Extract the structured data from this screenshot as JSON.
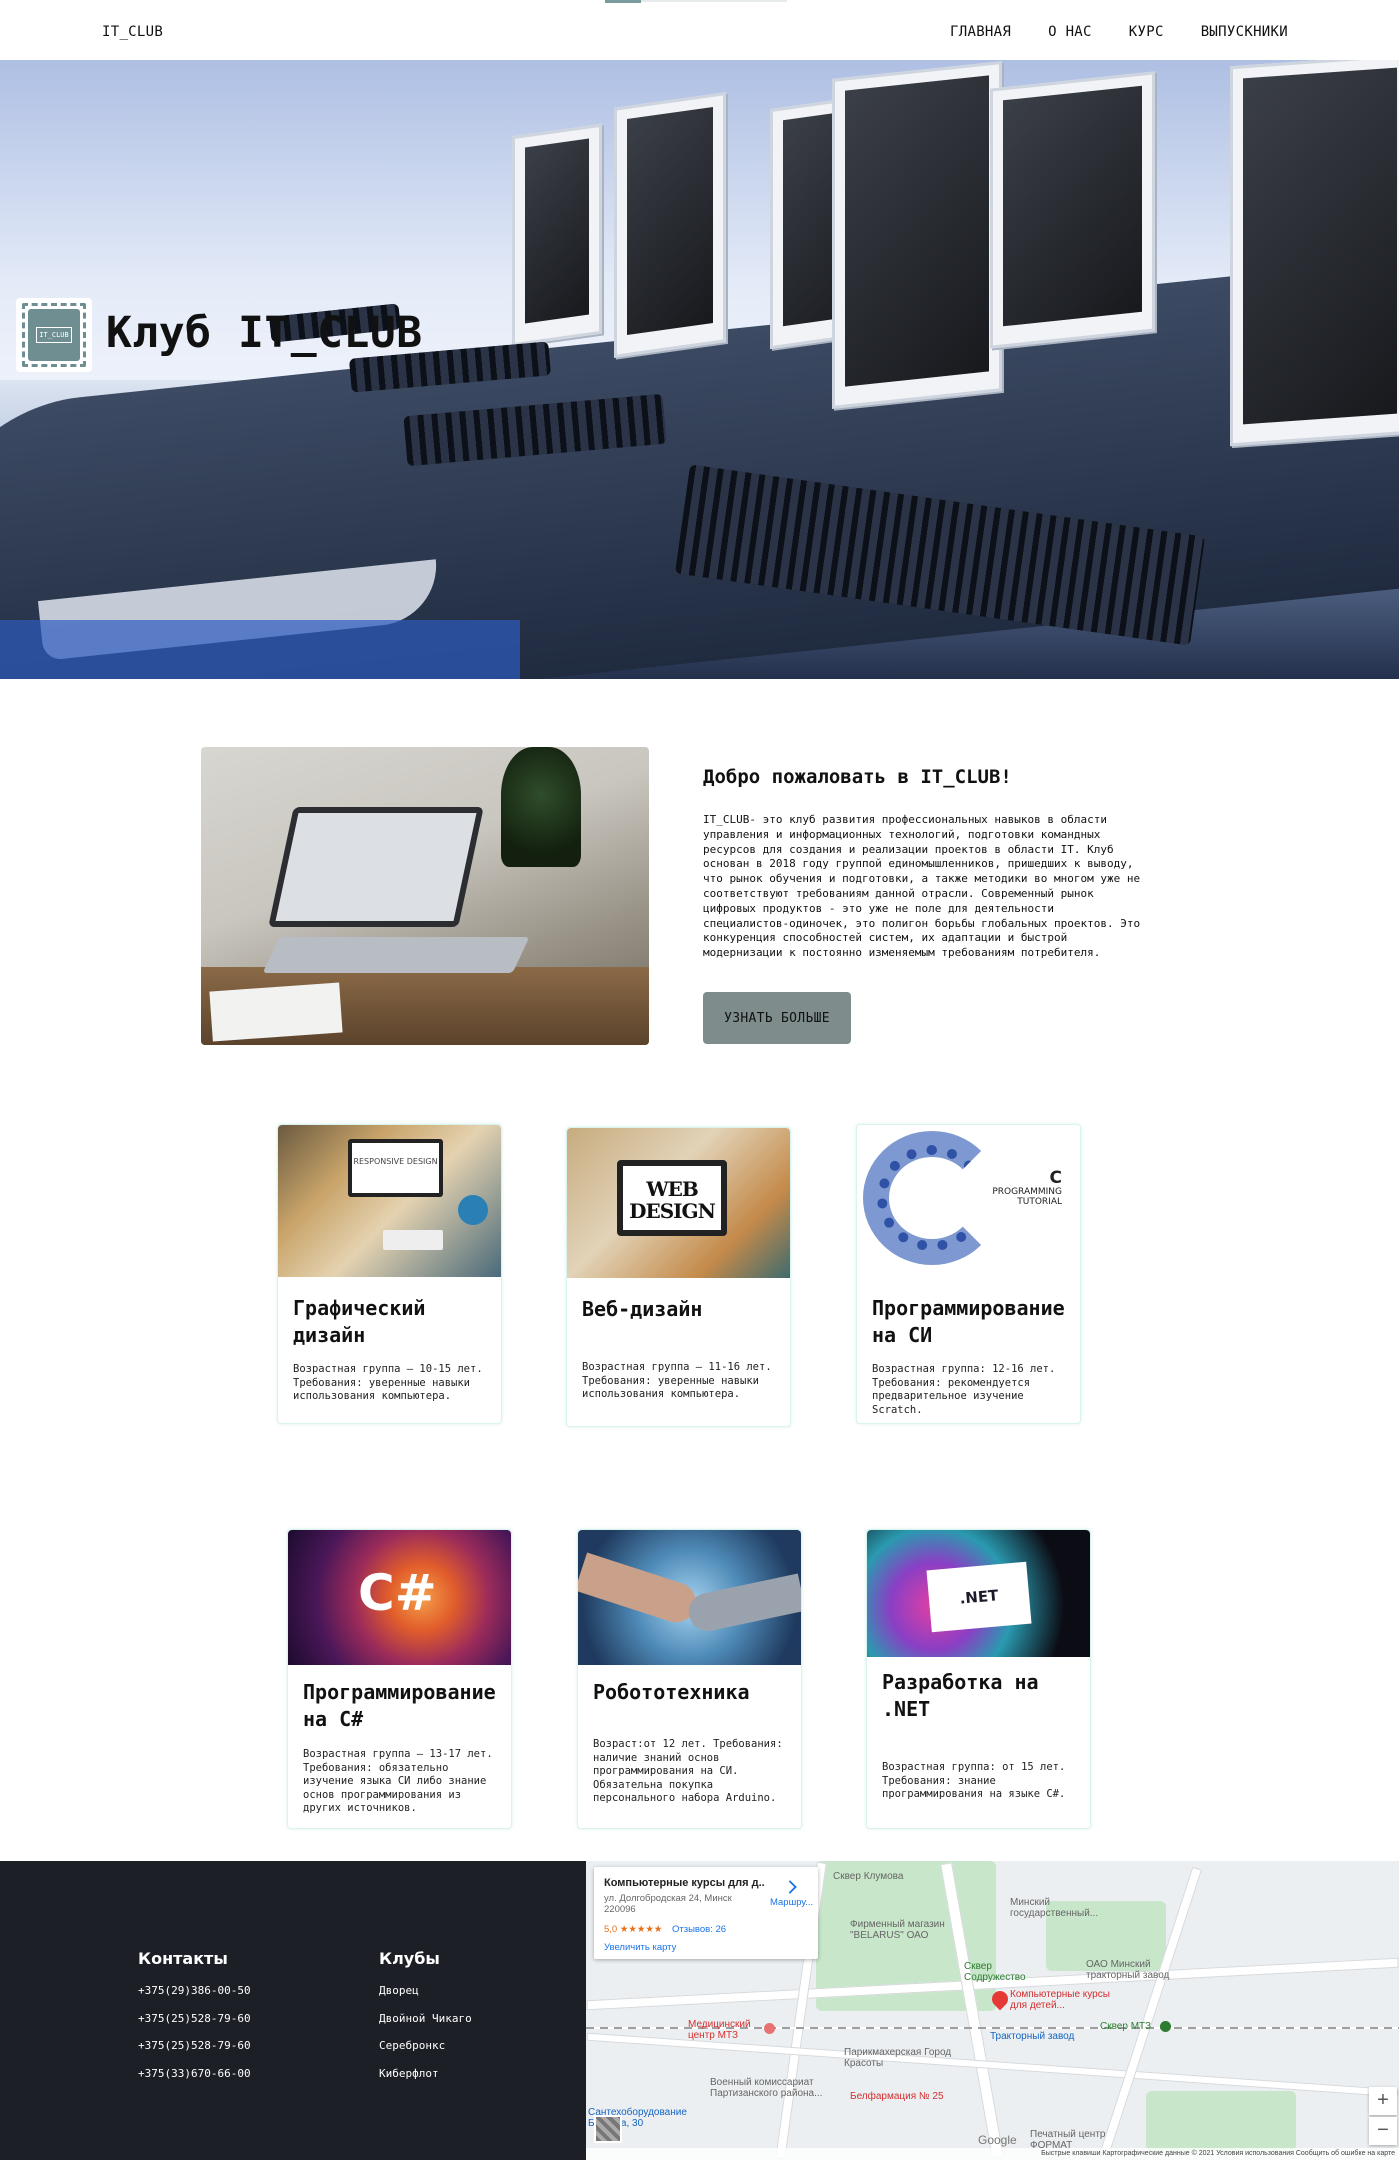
{
  "nav": {
    "brand": "IT_CLUB",
    "items": [
      "ГЛАВНАЯ",
      "О НАС",
      "КУРС",
      "ВЫПУСКНИКИ"
    ]
  },
  "hero": {
    "logo_text": "IT_CLUB",
    "title": "Клуб IT_CLUB"
  },
  "welcome": {
    "title": "Добро пожаловать в IT_CLUB!",
    "text": "IT_CLUB- это клуб развития профессиональных навыков в области управления и информационных технологий, подготовки командных ресурсов для создания и реализации проектов в области IT. Клуб основан в 2018 году группой единомышленников, пришедших к выводу, что рынок обучения и подготовки, а также методики во многом уже не соответствуют требованиям данной отрасли. Современный рынок цифровых продуктов - это уже не поле для деятельности специалистов-одиночек, это полигон борьбы глобальных проектов. Это конкуренция способностей систем, их адаптации и быстрой модернизации к постоянно изменяемым требованиям потребителя.",
    "button": "УЗНАТЬ БОЛЬШЕ"
  },
  "courses_row1": [
    {
      "title": "Графический дизайн",
      "desc": "Возрастная группа – 10-15 лет. Требования: уверенные навыки использования компьютера.",
      "image_text": "RESPONSIVE DESIGN"
    },
    {
      "title": "Веб-дизайн",
      "desc": "Возрастная группа – 11-16 лет. Требования: уверенные навыки использования компьютера.",
      "image_text": "WEB DESIGN"
    },
    {
      "title": "Программирование на СИ",
      "desc": "Возрастная группа: 12-16 лет. Требования: рекомендуется предварительное изучение Scratch.",
      "image_text_big": "C",
      "image_text": "PROGRAMMING TUTORIAL"
    }
  ],
  "courses_row2": [
    {
      "title": "Программирование на C#",
      "desc": "Возрастная группа – 13-17 лет. Требования: обязательно изучение языка СИ либо знание основ программирования из других источников.",
      "image_text": "C#"
    },
    {
      "title": "Робототехника",
      "desc": "Возраст:от 12 лет. Требования: наличие знаний основ программирования на СИ. Обязательна покупка персонального набора Arduino."
    },
    {
      "title": "Разработка на .NET",
      "desc": "Возрастная группа: от 15 лет. Требования: знание программирования на языке C#.",
      "image_text": ".NET"
    }
  ],
  "footer": {
    "contacts_title": "Контакты",
    "phones": [
      "+375(29)386-00-50",
      "+375(25)528-79-60",
      "+375(25)528-79-60",
      "+375(33)670-66-00"
    ],
    "clubs_title": "Клубы",
    "clubs": [
      "Дворец",
      "Двойной Чикаго",
      "Серебронкс",
      "Киберфлот"
    ]
  },
  "map": {
    "card_title": "Компьютерные курсы для д...",
    "card_address": "ул. Долгобродская 24, Минск 220096",
    "card_rating": "5,0 ★★★★★",
    "card_reviews": "Отзывов: 26",
    "card_link": "Увеличить карту",
    "card_route": "Маршру...",
    "labels": {
      "skver_klumova": "Сквер Клумова",
      "minsk_gos": "Минский государственный...",
      "belarus": "Фирменный магазин \"BELARUS\" ОАО",
      "skver_sodr": "Сквер Содружество",
      "oao_trakt": "ОАО Минский тракторный завод",
      "target": "Компьютерные курсы для детей...",
      "skver_mts": "Сквер МТЗ",
      "med": "Медицинский центр МТЗ",
      "trakt": "Тракторный завод",
      "parik": "Парикмахерская Город Красоты",
      "voen": "Военный комиссариат Партизанского района...",
      "belfarm": "Белфармация № 25",
      "santeh": "Сантехоборудование Бракова, 30",
      "pechat": "Печатный центр ФОРМАТ"
    },
    "google": "Google",
    "attribution": "Быстрые клавиши   Картографические данные © 2021   Условия использования   Сообщить об ошибке на карте"
  }
}
